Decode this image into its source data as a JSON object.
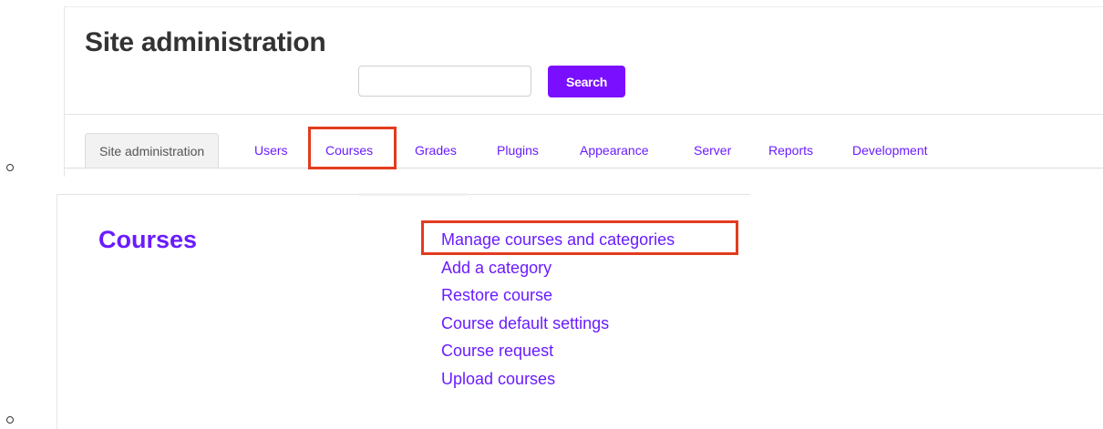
{
  "header": {
    "title": "Site administration"
  },
  "search": {
    "placeholder": "",
    "value": "",
    "button_label": "Search"
  },
  "tabs": [
    {
      "label": "Site administration",
      "active": true
    },
    {
      "label": "Users"
    },
    {
      "label": "Courses",
      "highlighted": true
    },
    {
      "label": "Grades"
    },
    {
      "label": "Plugins"
    },
    {
      "label": "Appearance"
    },
    {
      "label": "Server"
    },
    {
      "label": "Reports"
    },
    {
      "label": "Development"
    }
  ],
  "courses_section": {
    "heading": "Courses",
    "links": [
      {
        "label": "Manage courses and categories",
        "highlighted": true
      },
      {
        "label": "Add a category"
      },
      {
        "label": "Restore course"
      },
      {
        "label": "Course default settings"
      },
      {
        "label": "Course request"
      },
      {
        "label": "Upload courses"
      }
    ]
  },
  "colors": {
    "accent": "#7a0fff",
    "link": "#6a1bff",
    "highlight": "#e23b1e",
    "title": "#333333"
  }
}
